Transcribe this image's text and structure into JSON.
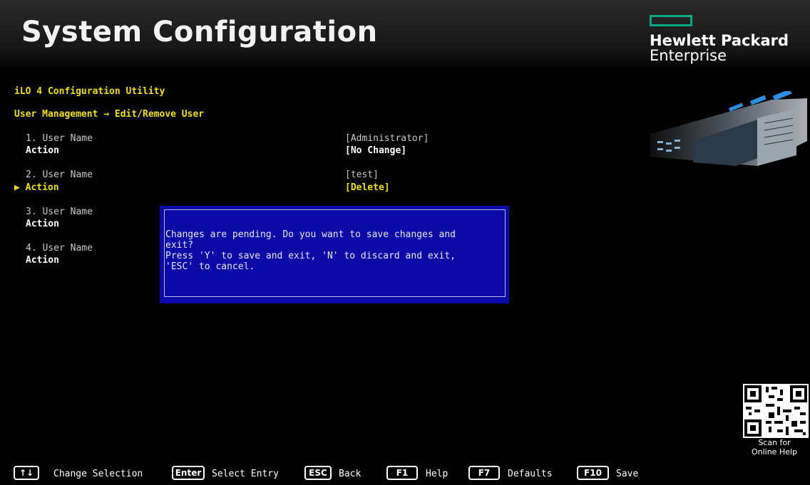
{
  "header": {
    "title": "System Configuration",
    "brand_line1": "Hewlett Packard",
    "brand_line2": "Enterprise",
    "brand_color": "#01a982"
  },
  "utility_title": "iLO 4 Configuration Utility",
  "breadcrumb": "User Management → Edit/Remove User",
  "users": [
    {
      "name_label": "1. User Name",
      "name_value": "[Administrator]",
      "action_label": "Action",
      "action_value": "[No Change]"
    },
    {
      "name_label": "2. User Name",
      "name_value": "[test]",
      "action_label": "▶ Action",
      "action_value": "[Delete]"
    },
    {
      "name_label": "3. User Name",
      "action_label": "Action"
    },
    {
      "name_label": "4. User Name",
      "action_label": "Action"
    }
  ],
  "dialog": {
    "line1": "Changes are pending. Do you want to save changes and",
    "line2": "exit?",
    "line3": "Press 'Y' to save and exit, 'N' to discard and exit,",
    "line4": "'ESC' to cancel."
  },
  "help": {
    "caption_line1": "Scan for",
    "caption_line2": "Online Help"
  },
  "footer": {
    "keys": [
      {
        "key": "↑↓",
        "label": "Change Selection"
      },
      {
        "key": "Enter",
        "label": "Select Entry"
      },
      {
        "key": "ESC",
        "label": "Back"
      },
      {
        "key": "F1",
        "label": "Help"
      },
      {
        "key": "F7",
        "label": "Defaults"
      },
      {
        "key": "F10",
        "label": "Save"
      }
    ]
  }
}
